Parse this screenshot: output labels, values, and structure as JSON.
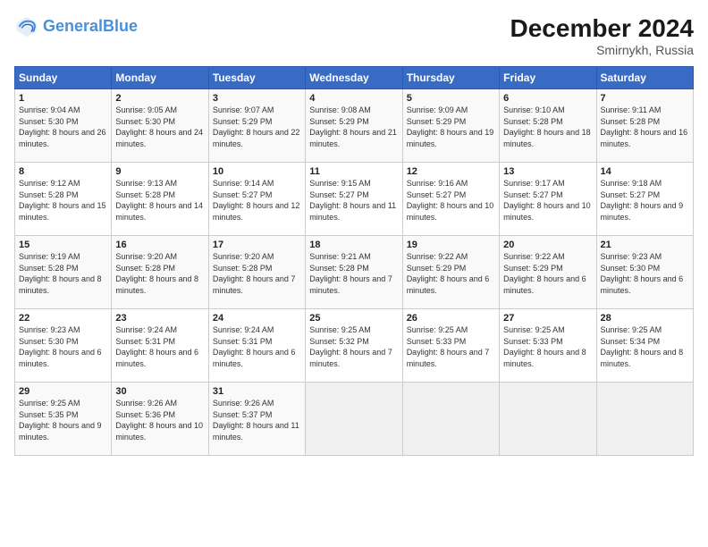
{
  "header": {
    "logo_line1": "General",
    "logo_line2": "Blue",
    "month": "December 2024",
    "location": "Smirnykh, Russia"
  },
  "weekdays": [
    "Sunday",
    "Monday",
    "Tuesday",
    "Wednesday",
    "Thursday",
    "Friday",
    "Saturday"
  ],
  "weeks": [
    [
      {
        "day": "1",
        "sunrise": "9:04 AM",
        "sunset": "5:30 PM",
        "daylight": "8 hours and 26 minutes."
      },
      {
        "day": "2",
        "sunrise": "9:05 AM",
        "sunset": "5:30 PM",
        "daylight": "8 hours and 24 minutes."
      },
      {
        "day": "3",
        "sunrise": "9:07 AM",
        "sunset": "5:29 PM",
        "daylight": "8 hours and 22 minutes."
      },
      {
        "day": "4",
        "sunrise": "9:08 AM",
        "sunset": "5:29 PM",
        "daylight": "8 hours and 21 minutes."
      },
      {
        "day": "5",
        "sunrise": "9:09 AM",
        "sunset": "5:29 PM",
        "daylight": "8 hours and 19 minutes."
      },
      {
        "day": "6",
        "sunrise": "9:10 AM",
        "sunset": "5:28 PM",
        "daylight": "8 hours and 18 minutes."
      },
      {
        "day": "7",
        "sunrise": "9:11 AM",
        "sunset": "5:28 PM",
        "daylight": "8 hours and 16 minutes."
      }
    ],
    [
      {
        "day": "8",
        "sunrise": "9:12 AM",
        "sunset": "5:28 PM",
        "daylight": "8 hours and 15 minutes."
      },
      {
        "day": "9",
        "sunrise": "9:13 AM",
        "sunset": "5:28 PM",
        "daylight": "8 hours and 14 minutes."
      },
      {
        "day": "10",
        "sunrise": "9:14 AM",
        "sunset": "5:27 PM",
        "daylight": "8 hours and 12 minutes."
      },
      {
        "day": "11",
        "sunrise": "9:15 AM",
        "sunset": "5:27 PM",
        "daylight": "8 hours and 11 minutes."
      },
      {
        "day": "12",
        "sunrise": "9:16 AM",
        "sunset": "5:27 PM",
        "daylight": "8 hours and 10 minutes."
      },
      {
        "day": "13",
        "sunrise": "9:17 AM",
        "sunset": "5:27 PM",
        "daylight": "8 hours and 10 minutes."
      },
      {
        "day": "14",
        "sunrise": "9:18 AM",
        "sunset": "5:27 PM",
        "daylight": "8 hours and 9 minutes."
      }
    ],
    [
      {
        "day": "15",
        "sunrise": "9:19 AM",
        "sunset": "5:28 PM",
        "daylight": "8 hours and 8 minutes."
      },
      {
        "day": "16",
        "sunrise": "9:20 AM",
        "sunset": "5:28 PM",
        "daylight": "8 hours and 8 minutes."
      },
      {
        "day": "17",
        "sunrise": "9:20 AM",
        "sunset": "5:28 PM",
        "daylight": "8 hours and 7 minutes."
      },
      {
        "day": "18",
        "sunrise": "9:21 AM",
        "sunset": "5:28 PM",
        "daylight": "8 hours and 7 minutes."
      },
      {
        "day": "19",
        "sunrise": "9:22 AM",
        "sunset": "5:29 PM",
        "daylight": "8 hours and 6 minutes."
      },
      {
        "day": "20",
        "sunrise": "9:22 AM",
        "sunset": "5:29 PM",
        "daylight": "8 hours and 6 minutes."
      },
      {
        "day": "21",
        "sunrise": "9:23 AM",
        "sunset": "5:30 PM",
        "daylight": "8 hours and 6 minutes."
      }
    ],
    [
      {
        "day": "22",
        "sunrise": "9:23 AM",
        "sunset": "5:30 PM",
        "daylight": "8 hours and 6 minutes."
      },
      {
        "day": "23",
        "sunrise": "9:24 AM",
        "sunset": "5:31 PM",
        "daylight": "8 hours and 6 minutes."
      },
      {
        "day": "24",
        "sunrise": "9:24 AM",
        "sunset": "5:31 PM",
        "daylight": "8 hours and 6 minutes."
      },
      {
        "day": "25",
        "sunrise": "9:25 AM",
        "sunset": "5:32 PM",
        "daylight": "8 hours and 7 minutes."
      },
      {
        "day": "26",
        "sunrise": "9:25 AM",
        "sunset": "5:33 PM",
        "daylight": "8 hours and 7 minutes."
      },
      {
        "day": "27",
        "sunrise": "9:25 AM",
        "sunset": "5:33 PM",
        "daylight": "8 hours and 8 minutes."
      },
      {
        "day": "28",
        "sunrise": "9:25 AM",
        "sunset": "5:34 PM",
        "daylight": "8 hours and 8 minutes."
      }
    ],
    [
      {
        "day": "29",
        "sunrise": "9:25 AM",
        "sunset": "5:35 PM",
        "daylight": "8 hours and 9 minutes."
      },
      {
        "day": "30",
        "sunrise": "9:26 AM",
        "sunset": "5:36 PM",
        "daylight": "8 hours and 10 minutes."
      },
      {
        "day": "31",
        "sunrise": "9:26 AM",
        "sunset": "5:37 PM",
        "daylight": "8 hours and 11 minutes."
      },
      null,
      null,
      null,
      null
    ]
  ]
}
